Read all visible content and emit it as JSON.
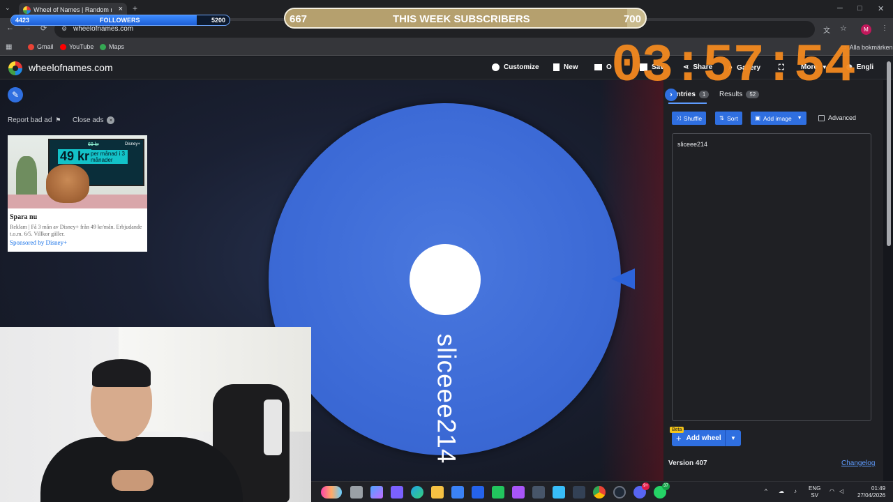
{
  "browser": {
    "tab_title": "Wheel of Names | Random nam",
    "tab_close": "×",
    "new_tab": "+",
    "url": "wheelofnames.com",
    "nav": {
      "back": "←",
      "forward": "→",
      "reload": "⟳"
    },
    "window_controls": {
      "minimize": "─",
      "maximize": "□",
      "close": "✕"
    },
    "bookmarks": [
      {
        "label": "Gmail",
        "color": "#ea4335"
      },
      {
        "label": "YouTube",
        "color": "#ff0000"
      },
      {
        "label": "Maps",
        "color": "#34a853"
      }
    ],
    "all_bookmarks": "Alla bokmärken",
    "profile_initial": "M"
  },
  "overlay": {
    "followers": {
      "current": "4423",
      "label": "FOLLOWERS",
      "goal": "5200",
      "progress_fraction": 0.85
    },
    "subscribers": {
      "current": "667",
      "label": "THIS WEEK SUBSCRIBERS",
      "goal": "700",
      "progress_fraction": 0.95
    },
    "timer": "03:57:54",
    "colors": {
      "timer": "#f58a1f",
      "followers_fill": "#3c8bff"
    }
  },
  "app": {
    "site_name": "wheelofnames.com",
    "nav": {
      "customize": "Customize",
      "new": "New",
      "open": "O",
      "save": "Sav",
      "share": "Share",
      "gallery": "Gallery",
      "more": "More",
      "language": "Engli"
    },
    "ad_controls": {
      "report": "Report bad ad",
      "close": "Close ads",
      "close_x": "×"
    },
    "ad": {
      "price": "49 kr",
      "old_price": "69 kr",
      "price_sub": "per månad i 3 månader",
      "brand": "Disney+",
      "headline": "Spara nu",
      "body": "Reklam | Få 3 mån av Disney+ från 49 kr/mån. Erbjudande t.o.m. 6/5. Villkor gäller.",
      "sponsor": "Sponsored by Disney+"
    },
    "wheel": {
      "entry_label": "sliceee214",
      "color": "#3c6ad6"
    },
    "panel": {
      "entries_tab": "Entries",
      "entries_count": "1",
      "results_tab": "Results",
      "results_count": "52",
      "shuffle": "Shuffle",
      "sort": "Sort",
      "add_image": "Add image",
      "advanced": "Advanced",
      "entries": [
        "sliceee214"
      ],
      "beta": "Beta",
      "add_wheel": "Add wheel",
      "version": "Version 407",
      "changelog": "Changelog"
    }
  },
  "taskbar": {
    "notifications": {
      "discord_badge": "9+",
      "whatsapp_badge": "37"
    },
    "language": "ENG",
    "layout": "SV",
    "time": "01:49",
    "date": "27/04/2026"
  }
}
